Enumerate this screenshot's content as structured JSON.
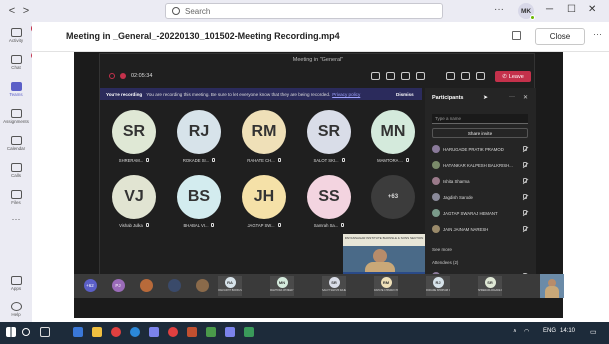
{
  "titlebar": {
    "search_placeholder": "Search",
    "user_initials": "MK",
    "more": "···",
    "minimize": "─",
    "maximize": "☐",
    "close": "✕"
  },
  "rail": {
    "items": [
      {
        "label": "Activity",
        "badge": "4"
      },
      {
        "label": "Chat",
        "badge": "16"
      },
      {
        "label": "Teams",
        "badge": ""
      },
      {
        "label": "Assignments",
        "badge": ""
      },
      {
        "label": "Calendar",
        "badge": ""
      },
      {
        "label": "Calls",
        "badge": ""
      },
      {
        "label": "Files",
        "badge": ""
      },
      {
        "label": "···",
        "badge": ""
      },
      {
        "label": "Apps",
        "badge": ""
      },
      {
        "label": "Help",
        "badge": ""
      }
    ]
  },
  "header": {
    "title": "Meeting in _General_-20220130_101502-Meeting Recording.mp4",
    "close_label": "Close",
    "more": "···"
  },
  "meeting": {
    "window_title": "Meeting in \"General\"",
    "timer": "02:05:34",
    "leave_label": "Leave",
    "banner_bold": "You're recording",
    "banner_text": "You are recording this meeting. Be sure to let everyone know that they are being recorded.",
    "banner_link": "Privacy policy",
    "banner_dismiss": "Dismiss",
    "tiles": [
      {
        "initials": "SR",
        "name": "SHRERAM...",
        "color": "#dfe8d5"
      },
      {
        "initials": "RJ",
        "name": "ROKADE SI...",
        "color": "#d7e3ea"
      },
      {
        "initials": "RM",
        "name": "RAHATE CH...",
        "color": "#efe0b8"
      },
      {
        "initials": "SR",
        "name": "SALOT SKI...",
        "color": "#d9dde8"
      },
      {
        "initials": "MN",
        "name": "MAMTORA ...",
        "color": "#d4eadc"
      },
      {
        "initials": "VJ",
        "name": "Vishab Julka",
        "color": "#e1e4d2"
      },
      {
        "initials": "BS",
        "name": "BHABAL VI...",
        "color": "#d3ecef"
      },
      {
        "initials": "JH",
        "name": "JAGTAP SW...",
        "color": "#f5e1a8"
      },
      {
        "initials": "SS",
        "name": "Samrah Sa...",
        "color": "#f3d4e0"
      }
    ],
    "more_count": "+63",
    "speaker_banner": "DNYANSAGAR INSTITUTE BHONSLE & SONS SECTION"
  },
  "participants": {
    "title": "Participants",
    "search_placeholder": "Type a name",
    "share_label": "Share invite",
    "rows": [
      {
        "name": "HARUGADE PRATIK PRAMOD",
        "color": "#8a7a9a"
      },
      {
        "name": "HATANKAR KALPESH BALKRISH...",
        "color": "#7a8a6a"
      },
      {
        "name": "Ishita Sharma",
        "color": "#9a7a8a"
      },
      {
        "name": "Jagdish Sarode",
        "color": "#8a8a9a"
      },
      {
        "name": "JAGTAP SWARAJ HEMANT",
        "color": "#7a9a8a"
      },
      {
        "name": "JAIN JAINAM NARESH",
        "color": "#9a8a6a"
      }
    ],
    "see_more": "See more",
    "attendees": "Attendees (2)",
    "last_row": "Samvid Raval"
  },
  "inner_taskbar": {
    "lang": "ENG",
    "lang2": "IN",
    "time": "11:55 AM",
    "date": "30-01-2022"
  },
  "strip": {
    "count": "+62",
    "big_tiles": [
      {
        "initials": "PJ",
        "color": "#9a6bb8"
      }
    ],
    "tiles": [
      {
        "initials": "RA",
        "name": "RAM ASHIT BORKUS",
        "color": "#d7e3ea"
      },
      {
        "initials": "MN",
        "name": "MAMTORA CHINMAY NILESH",
        "color": "#d4eadc"
      },
      {
        "initials": "SR",
        "name": "SALOT SAKSHI RAJESH",
        "color": "#d9dde8"
      },
      {
        "initials": "RM",
        "name": "RAHATE CHINMAY PRAMOD",
        "color": "#efe0b8"
      },
      {
        "initials": "RJ",
        "name": "ROKADE SHRIHARI JAGDISH",
        "color": "#d7e3ea"
      },
      {
        "initials": "SR",
        "name": "SHRERAM ARGADE DEEPAK",
        "color": "#dfe8d5"
      }
    ]
  },
  "taskbar": {
    "lang": "ENG",
    "time": "14:10"
  }
}
